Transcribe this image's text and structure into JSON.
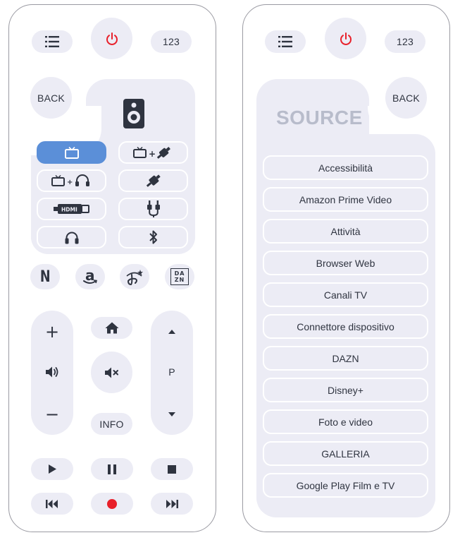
{
  "colors": {
    "power": "#e8202a",
    "accent": "#5b8fd8",
    "surface": "#ececf5",
    "ink": "#2f3440",
    "source_title": "#b8bccb"
  },
  "left": {
    "top": {
      "menu_icon": "list-icon",
      "power_icon": "power-icon",
      "numbers_label": "123"
    },
    "back_label": "BACK",
    "speaker_icon": "speaker-icon",
    "outputs": [
      {
        "icon": "tv-icon",
        "active": true
      },
      {
        "icon": "tv-plus-optical-icon",
        "active": false
      },
      {
        "icon": "tv-plus-headphones-icon",
        "active": false
      },
      {
        "icon": "optical-icon",
        "active": false
      },
      {
        "icon": "hdmi-icon",
        "active": false
      },
      {
        "icon": "rca-icon",
        "active": false
      },
      {
        "icon": "headphones-icon",
        "active": false
      },
      {
        "icon": "bluetooth-icon",
        "active": false
      }
    ],
    "apps": [
      {
        "icon": "netflix-icon",
        "label": "N"
      },
      {
        "icon": "amazon-icon",
        "label": "a"
      },
      {
        "icon": "disney-icon",
        "label": ""
      },
      {
        "icon": "dazn-icon",
        "label": "DA ZN"
      }
    ],
    "volume": {
      "plus": "+",
      "minus": "−"
    },
    "program": {
      "label": "P"
    },
    "info_label": "INFO"
  },
  "right": {
    "top": {
      "menu_icon": "list-icon",
      "power_icon": "power-icon",
      "numbers_label": "123"
    },
    "back_label": "BACK",
    "source_title": "SOURCE",
    "sources": [
      "Accessibilità",
      "Amazon Prime Video",
      "Attività",
      "Browser Web",
      "Canali TV",
      "Connettore dispositivo",
      "DAZN",
      "Disney+",
      "Foto e video",
      "GALLERIA",
      "Google Play Film e TV"
    ]
  }
}
